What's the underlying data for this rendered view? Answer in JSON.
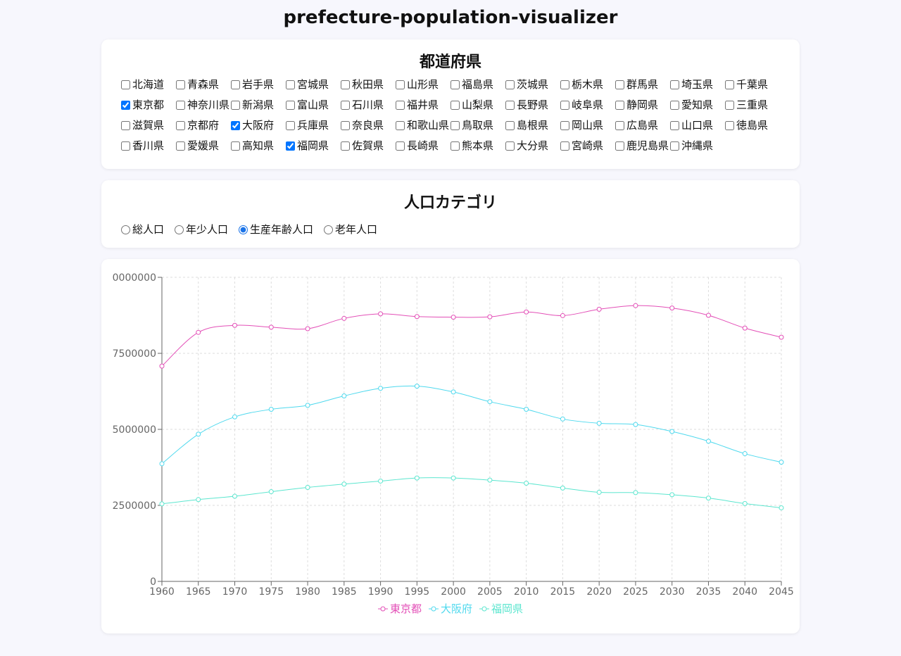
{
  "app": {
    "title": "prefecture-population-visualizer"
  },
  "prefectures": {
    "title": "都道府県",
    "items": [
      {
        "name": "北海道",
        "checked": false
      },
      {
        "name": "青森県",
        "checked": false
      },
      {
        "name": "岩手県",
        "checked": false
      },
      {
        "name": "宮城県",
        "checked": false
      },
      {
        "name": "秋田県",
        "checked": false
      },
      {
        "name": "山形県",
        "checked": false
      },
      {
        "name": "福島県",
        "checked": false
      },
      {
        "name": "茨城県",
        "checked": false
      },
      {
        "name": "栃木県",
        "checked": false
      },
      {
        "name": "群馬県",
        "checked": false
      },
      {
        "name": "埼玉県",
        "checked": false
      },
      {
        "name": "千葉県",
        "checked": false
      },
      {
        "name": "東京都",
        "checked": true
      },
      {
        "name": "神奈川県",
        "checked": false
      },
      {
        "name": "新潟県",
        "checked": false
      },
      {
        "name": "富山県",
        "checked": false
      },
      {
        "name": "石川県",
        "checked": false
      },
      {
        "name": "福井県",
        "checked": false
      },
      {
        "name": "山梨県",
        "checked": false
      },
      {
        "name": "長野県",
        "checked": false
      },
      {
        "name": "岐阜県",
        "checked": false
      },
      {
        "name": "静岡県",
        "checked": false
      },
      {
        "name": "愛知県",
        "checked": false
      },
      {
        "name": "三重県",
        "checked": false
      },
      {
        "name": "滋賀県",
        "checked": false
      },
      {
        "name": "京都府",
        "checked": false
      },
      {
        "name": "大阪府",
        "checked": true
      },
      {
        "name": "兵庫県",
        "checked": false
      },
      {
        "name": "奈良県",
        "checked": false
      },
      {
        "name": "和歌山県",
        "checked": false
      },
      {
        "name": "鳥取県",
        "checked": false
      },
      {
        "name": "島根県",
        "checked": false
      },
      {
        "name": "岡山県",
        "checked": false
      },
      {
        "name": "広島県",
        "checked": false
      },
      {
        "name": "山口県",
        "checked": false
      },
      {
        "name": "徳島県",
        "checked": false
      },
      {
        "name": "香川県",
        "checked": false
      },
      {
        "name": "愛媛県",
        "checked": false
      },
      {
        "name": "高知県",
        "checked": false
      },
      {
        "name": "福岡県",
        "checked": true
      },
      {
        "name": "佐賀県",
        "checked": false
      },
      {
        "name": "長崎県",
        "checked": false
      },
      {
        "name": "熊本県",
        "checked": false
      },
      {
        "name": "大分県",
        "checked": false
      },
      {
        "name": "宮崎県",
        "checked": false
      },
      {
        "name": "鹿児島県",
        "checked": false
      },
      {
        "name": "沖縄県",
        "checked": false
      }
    ]
  },
  "category": {
    "title": "人口カテゴリ",
    "options": [
      {
        "label": "総人口",
        "selected": false
      },
      {
        "label": "年少人口",
        "selected": false
      },
      {
        "label": "生産年齢人口",
        "selected": true
      },
      {
        "label": "老年人口",
        "selected": false
      }
    ]
  },
  "colors": {
    "accent": "#1a73e8"
  },
  "chart_data": {
    "type": "line",
    "x": [
      1960,
      1965,
      1970,
      1975,
      1980,
      1985,
      1990,
      1995,
      2000,
      2005,
      2010,
      2015,
      2020,
      2025,
      2030,
      2035,
      2040,
      2045
    ],
    "xlim": [
      1960,
      2045
    ],
    "ylim": [
      0,
      10000000
    ],
    "yticks": [
      0,
      2500000,
      5000000,
      7500000,
      10000000
    ],
    "ytick_labels": [
      "0",
      "2500000",
      "5000000",
      "7500000",
      "0000000"
    ],
    "grid": true,
    "legend": "bottom-center",
    "series": [
      {
        "name": "東京都",
        "color": "#e34fb7",
        "values": [
          7080000,
          8190000,
          8420000,
          8360000,
          8310000,
          8650000,
          8800000,
          8710000,
          8690000,
          8700000,
          8860000,
          8740000,
          8950000,
          9070000,
          8990000,
          8750000,
          8330000,
          8030000
        ]
      },
      {
        "name": "大阪府",
        "color": "#4fd9ee",
        "values": [
          3870000,
          4840000,
          5410000,
          5660000,
          5790000,
          6100000,
          6350000,
          6420000,
          6230000,
          5910000,
          5660000,
          5340000,
          5200000,
          5160000,
          4930000,
          4610000,
          4200000,
          3920000
        ]
      },
      {
        "name": "福岡県",
        "color": "#5ce6cf",
        "values": [
          2550000,
          2690000,
          2800000,
          2950000,
          3090000,
          3200000,
          3300000,
          3400000,
          3400000,
          3330000,
          3230000,
          3070000,
          2930000,
          2920000,
          2850000,
          2740000,
          2560000,
          2420000
        ]
      }
    ]
  }
}
